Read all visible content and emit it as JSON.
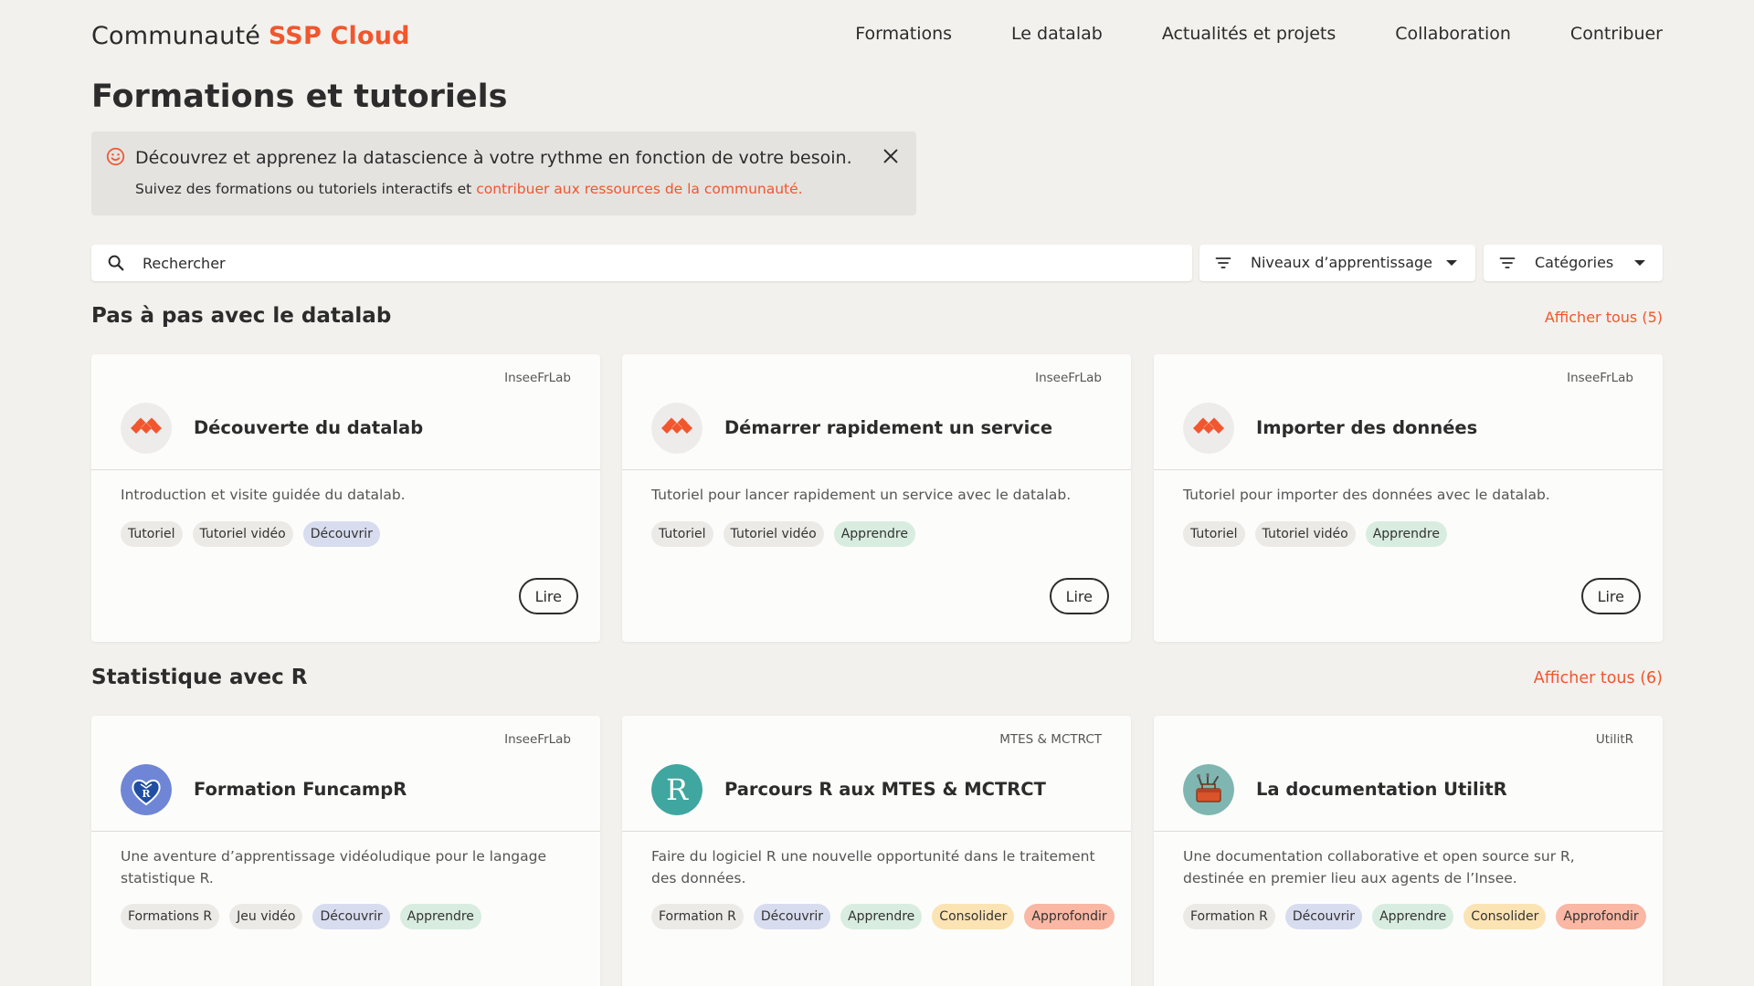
{
  "header": {
    "brand_prefix": "Communauté",
    "brand_name": "SSP Cloud",
    "nav": [
      "Formations",
      "Le datalab",
      "Actualités et projets",
      "Collaboration",
      "Contribuer"
    ]
  },
  "page_title": "Formations et tutoriels",
  "banner": {
    "headline": "Découvrez et apprenez la datascience à votre rythme en fonction de votre besoin.",
    "sub_text": "Suivez des formations ou tutoriels interactifs et",
    "sub_link": "contribuer aux ressources de la communauté."
  },
  "search": {
    "placeholder": "Rechercher"
  },
  "filters": {
    "levels": "Niveaux d’apprentissage",
    "categories": "Catégories"
  },
  "colors": {
    "accent": "#f1562e",
    "background": "#f2f1ed"
  },
  "sections": [
    {
      "title": "Pas à pas avec le datalab",
      "show_all": "Afficher tous (5)",
      "cards": [
        {
          "org": "InseeFrLab",
          "title": "Découverte du datalab",
          "desc": "Introduction et visite guidée du datalab.",
          "tags": [
            {
              "label": "Tutoriel",
              "kind": "neutral"
            },
            {
              "label": "Tutoriel vidéo",
              "kind": "neutral"
            },
            {
              "label": "Découvrir",
              "kind": "decouvrir"
            }
          ],
          "button": "Lire",
          "logo": "onyxia-icon"
        },
        {
          "org": "InseeFrLab",
          "title": "Démarrer rapidement un service",
          "desc": "Tutoriel pour lancer rapidement un service avec le datalab.",
          "tags": [
            {
              "label": "Tutoriel",
              "kind": "neutral"
            },
            {
              "label": "Tutoriel vidéo",
              "kind": "neutral"
            },
            {
              "label": "Apprendre",
              "kind": "apprendre"
            }
          ],
          "button": "Lire",
          "logo": "onyxia-icon"
        },
        {
          "org": "InseeFrLab",
          "title": "Importer des données",
          "desc": "Tutoriel pour importer des données avec le datalab.",
          "tags": [
            {
              "label": "Tutoriel",
              "kind": "neutral"
            },
            {
              "label": "Tutoriel vidéo",
              "kind": "neutral"
            },
            {
              "label": "Apprendre",
              "kind": "apprendre"
            }
          ],
          "button": "Lire",
          "logo": "onyxia-icon"
        }
      ]
    },
    {
      "title": "Statistique avec R",
      "show_all": "Afficher tous (6)",
      "cards": [
        {
          "org": "InseeFrLab",
          "title": "Formation FuncampR",
          "desc": "Une aventure d’apprentissage vidéoludique pour le langage statistique R.",
          "tags": [
            {
              "label": "Formations R",
              "kind": "neutral"
            },
            {
              "label": "Jeu vidéo",
              "kind": "neutral"
            },
            {
              "label": "Découvrir",
              "kind": "decouvrir"
            },
            {
              "label": "Apprendre",
              "kind": "apprendre"
            }
          ],
          "logo": "funcampr-heart-icon"
        },
        {
          "org": "MTES & MCTRCT",
          "title": "Parcours R aux MTES & MCTRCT",
          "desc": "Faire du logiciel R une nouvelle opportunité dans le traitement des données.",
          "tags": [
            {
              "label": "Formation R",
              "kind": "neutral"
            },
            {
              "label": "Découvrir",
              "kind": "decouvrir"
            },
            {
              "label": "Apprendre",
              "kind": "apprendre"
            },
            {
              "label": "Consolider",
              "kind": "consolider"
            },
            {
              "label": "Approfondir",
              "kind": "approfondir"
            }
          ],
          "logo": "r-letter-icon"
        },
        {
          "org": "UtilitR",
          "title": "La documentation UtilitR",
          "desc": "Une documentation collaborative et open source sur R, destinée en premier lieu aux agents de l’Insee.",
          "tags": [
            {
              "label": "Formation R",
              "kind": "neutral"
            },
            {
              "label": "Découvrir",
              "kind": "decouvrir"
            },
            {
              "label": "Apprendre",
              "kind": "apprendre"
            },
            {
              "label": "Consolider",
              "kind": "consolider"
            },
            {
              "label": "Approfondir",
              "kind": "approfondir"
            }
          ],
          "logo": "toolbox-icon"
        }
      ]
    }
  ]
}
